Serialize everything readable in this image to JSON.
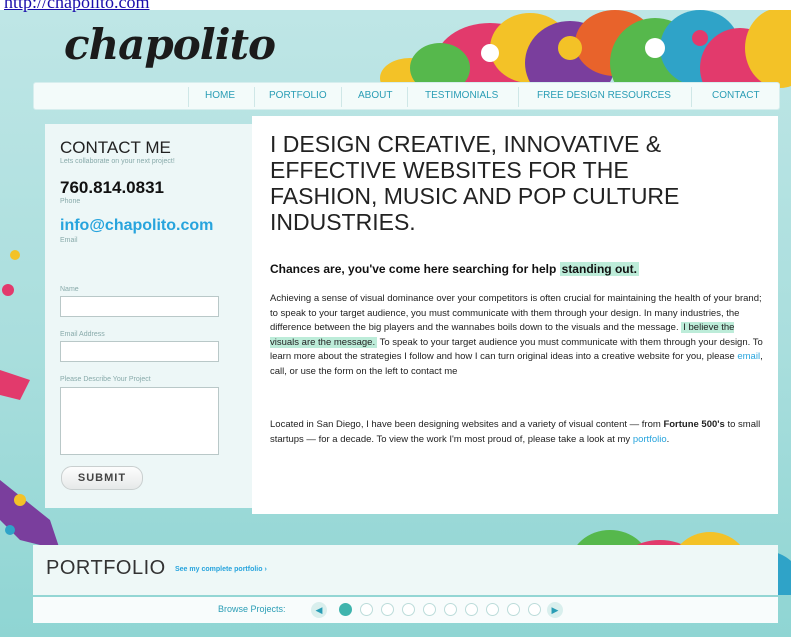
{
  "top_link": "http://chapolito.com",
  "logo": "chapolito",
  "nav": {
    "items": [
      "HOME",
      "PORTFOLIO",
      "ABOUT",
      "TESTIMONIALS",
      "FREE DESIGN RESOURCES",
      "CONTACT"
    ],
    "active": "HOME"
  },
  "contact": {
    "title": "CONTACT ME",
    "subtitle": "Lets collaborate on your next project!",
    "phone": "760.814.0831",
    "phone_label": "Phone",
    "email": "info@chapolito.com",
    "email_label": "Email"
  },
  "form": {
    "name_label": "Name",
    "email_label": "Email Address",
    "project_label": "Please Describe Your Project",
    "submit_label": "SUBMIT"
  },
  "main": {
    "headline": "I design creative, innovative & effective websites for the fashion, music and pop culture industries.",
    "lead": "Chances are, you've come here searching for help",
    "lead_highlight": "standing out.",
    "p1": {
      "text1": "Achieving a sense of visual dominance over your competitors is often crucial for maintaining the health of your brand; to speak to your target audience, you must communicate with them through your design. In many industries, the difference between the big players and the wannabes boils down to the visuals and the message.",
      "highlight": "I believe the visuals are the message.",
      "text2": "To speak to your target audience you must communicate with them through your design. To learn more about the strategies I follow and how I can turn original ideas into a creative website for you, please",
      "email_link": "email",
      "text3": ", call, or use the form on the left to contact me"
    },
    "p2": {
      "text1": "Located in San Diego, I have been designing websites and a variety of visual content — from",
      "bold": "Fortune 500's",
      "text2": "to small startups — for a decade. To view the work I'm most proud of, please take a look at my",
      "portfolio_link": "portfolio",
      "text3": "."
    }
  },
  "portfolio": {
    "title": "PORTFOLIO",
    "link": "See my complete portfolio ›",
    "browse_label": "Browse Projects:",
    "prev_icon": "arrow-left-icon",
    "next_icon": "arrow-right-icon",
    "page_count": 10,
    "active_page": 1
  },
  "colors": {
    "accent": "#27a4dd",
    "nav_text": "#2a9db5",
    "highlight": "#bdecd9",
    "background": "#a9dedd"
  }
}
